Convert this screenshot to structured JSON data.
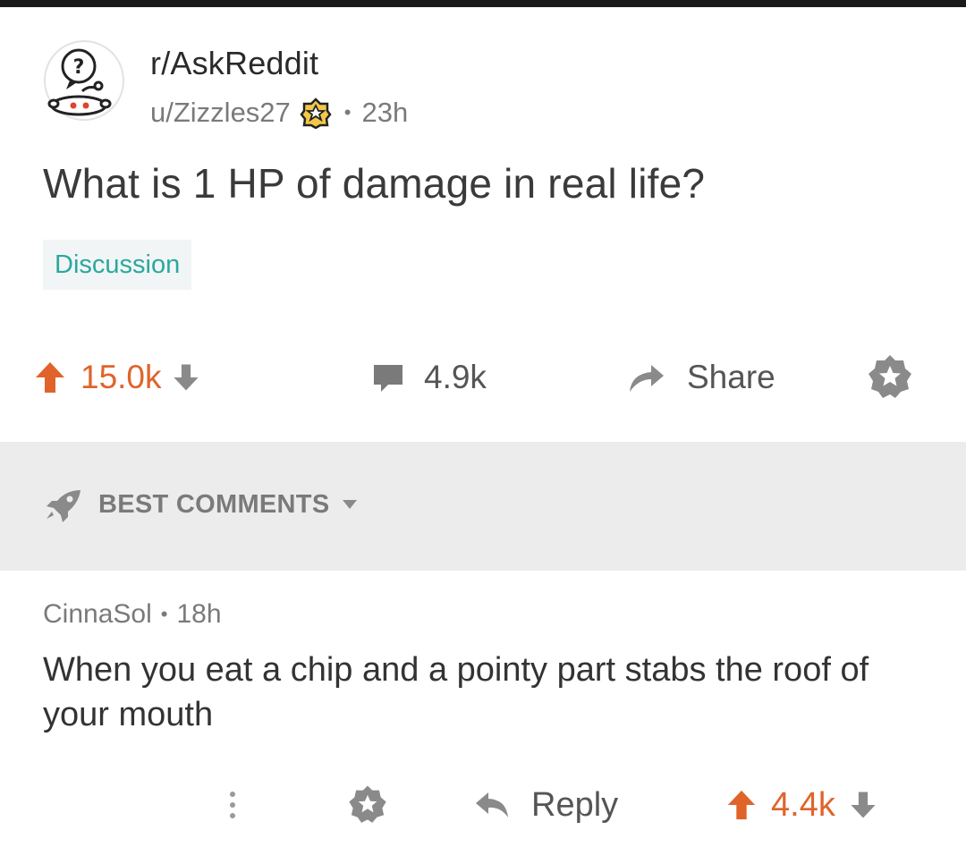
{
  "post": {
    "subreddit": "r/AskReddit",
    "author": "u/Zizzles27",
    "separator": "•",
    "age": "23h",
    "title": "What is 1 HP of damage in real life?",
    "flair": "Discussion",
    "icons": {
      "subreddit_avatar": "askreddit-snoo-icon",
      "author_flair": "award-badge-icon"
    }
  },
  "actions": {
    "upvote_icon": "arrow-up-icon",
    "score": "15.0k",
    "downvote_icon": "arrow-down-icon",
    "comment_icon": "speech-bubble-icon",
    "comment_count": "4.9k",
    "share_icon": "share-arrow-icon",
    "share_label": "Share",
    "save_icon": "star-icon"
  },
  "sort": {
    "icon": "rocket-icon",
    "label": "BEST COMMENTS",
    "caret_icon": "caret-down-icon"
  },
  "comment": {
    "author": "CinnaSol",
    "separator": "•",
    "age": "18h",
    "body": "When you eat a chip and a pointy part stabs the roof of your mouth",
    "more_icon": "vertical-ellipsis-icon",
    "save_icon": "star-icon",
    "reply_icon": "reply-arrow-icon",
    "reply_label": "Reply",
    "upvote_icon": "arrow-up-icon",
    "score": "4.4k",
    "downvote_icon": "arrow-down-icon"
  },
  "colors": {
    "upvote": "#e0642a",
    "flair_text": "#2aa8a0",
    "flair_bg": "#f2f5f5",
    "band_bg": "#ececec",
    "muted": "#7a7a7a"
  }
}
